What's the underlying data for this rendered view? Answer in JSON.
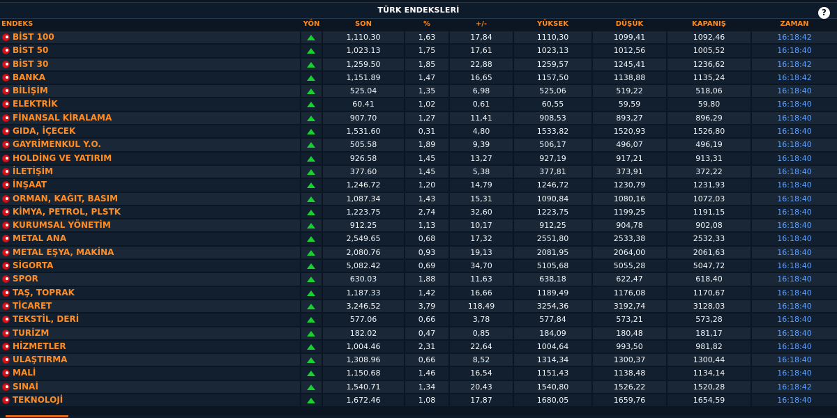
{
  "title": "TÜRK ENDEKSLERİ",
  "help_icon": "?",
  "colors": {
    "accent": "#ff8d24",
    "up": "#18d030",
    "time": "#5fa0ff"
  },
  "columns": [
    "ENDEKS",
    "YÖN",
    "SON",
    "%",
    "+/-",
    "YÜKSEK",
    "DÜŞÜK",
    "KAPANIŞ",
    "ZAMAN"
  ],
  "rows": [
    {
      "name": "BİST 100",
      "dir": "up",
      "son": "1,110.30",
      "pct": "1,63",
      "chg": "17,84",
      "high": "1110,30",
      "low": "1099,41",
      "close": "1092,46",
      "time": "16:18:42"
    },
    {
      "name": "BİST 50",
      "dir": "up",
      "son": "1,023.13",
      "pct": "1,75",
      "chg": "17,61",
      "high": "1023,13",
      "low": "1012,56",
      "close": "1005,52",
      "time": "16:18:40"
    },
    {
      "name": "BİST 30",
      "dir": "up",
      "son": "1,259.50",
      "pct": "1,85",
      "chg": "22,88",
      "high": "1259,57",
      "low": "1245,41",
      "close": "1236,62",
      "time": "16:18:42"
    },
    {
      "name": "BANKA",
      "dir": "up",
      "son": "1,151.89",
      "pct": "1,47",
      "chg": "16,65",
      "high": "1157,50",
      "low": "1138,88",
      "close": "1135,24",
      "time": "16:18:42"
    },
    {
      "name": "BİLİŞİM",
      "dir": "up",
      "son": "525.04",
      "pct": "1,35",
      "chg": "6,98",
      "high": "525,06",
      "low": "519,22",
      "close": "518,06",
      "time": "16:18:40"
    },
    {
      "name": "ELEKTRİK",
      "dir": "up",
      "son": "60.41",
      "pct": "1,02",
      "chg": "0,61",
      "high": "60,55",
      "low": "59,59",
      "close": "59,80",
      "time": "16:18:40"
    },
    {
      "name": "FİNANSAL KİRALAMA",
      "dir": "up",
      "son": "907.70",
      "pct": "1,27",
      "chg": "11,41",
      "high": "908,53",
      "low": "893,27",
      "close": "896,29",
      "time": "16:18:40"
    },
    {
      "name": "GIDA, İÇECEK",
      "dir": "up",
      "son": "1,531.60",
      "pct": "0,31",
      "chg": "4,80",
      "high": "1533,82",
      "low": "1520,93",
      "close": "1526,80",
      "time": "16:18:40"
    },
    {
      "name": "GAYRİMENKUL Y.O.",
      "dir": "up",
      "son": "505.58",
      "pct": "1,89",
      "chg": "9,39",
      "high": "506,17",
      "low": "496,07",
      "close": "496,19",
      "time": "16:18:40"
    },
    {
      "name": "HOLDİNG VE YATIRIM",
      "dir": "up",
      "son": "926.58",
      "pct": "1,45",
      "chg": "13,27",
      "high": "927,19",
      "low": "917,21",
      "close": "913,31",
      "time": "16:18:40"
    },
    {
      "name": "İLETİŞİM",
      "dir": "up",
      "son": "377.60",
      "pct": "1,45",
      "chg": "5,38",
      "high": "377,81",
      "low": "373,91",
      "close": "372,22",
      "time": "16:18:40"
    },
    {
      "name": "İNŞAAT",
      "dir": "up",
      "son": "1,246.72",
      "pct": "1,20",
      "chg": "14,79",
      "high": "1246,72",
      "low": "1230,79",
      "close": "1231,93",
      "time": "16:18:40"
    },
    {
      "name": "ORMAN, KAĞIT, BASIM",
      "dir": "up",
      "son": "1,087.34",
      "pct": "1,43",
      "chg": "15,31",
      "high": "1090,84",
      "low": "1080,16",
      "close": "1072,03",
      "time": "16:18:40"
    },
    {
      "name": "KİMYA, PETROL, PLSTK",
      "dir": "up",
      "son": "1,223.75",
      "pct": "2,74",
      "chg": "32,60",
      "high": "1223,75",
      "low": "1199,25",
      "close": "1191,15",
      "time": "16:18:40"
    },
    {
      "name": "KURUMSAL YÖNETİM",
      "dir": "up",
      "son": "912.25",
      "pct": "1,13",
      "chg": "10,17",
      "high": "912,25",
      "low": "904,78",
      "close": "902,08",
      "time": "16:18:40"
    },
    {
      "name": "METAL ANA",
      "dir": "up",
      "son": "2,549.65",
      "pct": "0,68",
      "chg": "17,32",
      "high": "2551,80",
      "low": "2533,38",
      "close": "2532,33",
      "time": "16:18:40"
    },
    {
      "name": "METAL EŞYA, MAKİNA",
      "dir": "up",
      "son": "2,080.76",
      "pct": "0,93",
      "chg": "19,13",
      "high": "2081,95",
      "low": "2064,00",
      "close": "2061,63",
      "time": "16:18:40"
    },
    {
      "name": "SİGORTA",
      "dir": "up",
      "son": "5,082.42",
      "pct": "0,69",
      "chg": "34,70",
      "high": "5105,68",
      "low": "5055,28",
      "close": "5047,72",
      "time": "16:18:40"
    },
    {
      "name": "SPOR",
      "dir": "up",
      "son": "630.03",
      "pct": "1,88",
      "chg": "11,63",
      "high": "638,18",
      "low": "622,47",
      "close": "618,40",
      "time": "16:18:40"
    },
    {
      "name": "TAŞ, TOPRAK",
      "dir": "up",
      "son": "1,187.33",
      "pct": "1,42",
      "chg": "16,66",
      "high": "1189,49",
      "low": "1176,08",
      "close": "1170,67",
      "time": "16:18:40"
    },
    {
      "name": "TİCARET",
      "dir": "up",
      "son": "3,246.52",
      "pct": "3,79",
      "chg": "118,49",
      "high": "3254,36",
      "low": "3192,74",
      "close": "3128,03",
      "time": "16:18:40"
    },
    {
      "name": "TEKSTİL, DERİ",
      "dir": "up",
      "son": "577.06",
      "pct": "0,66",
      "chg": "3,78",
      "high": "577,84",
      "low": "573,21",
      "close": "573,28",
      "time": "16:18:40"
    },
    {
      "name": "TURİZM",
      "dir": "up",
      "son": "182.02",
      "pct": "0,47",
      "chg": "0,85",
      "high": "184,09",
      "low": "180,48",
      "close": "181,17",
      "time": "16:18:40"
    },
    {
      "name": "HİZMETLER",
      "dir": "up",
      "son": "1,004.46",
      "pct": "2,31",
      "chg": "22,64",
      "high": "1004,64",
      "low": "993,50",
      "close": "981,82",
      "time": "16:18:40"
    },
    {
      "name": "ULAŞTIRMA",
      "dir": "up",
      "son": "1,308.96",
      "pct": "0,66",
      "chg": "8,52",
      "high": "1314,34",
      "low": "1300,37",
      "close": "1300,44",
      "time": "16:18:40"
    },
    {
      "name": "MALİ",
      "dir": "up",
      "son": "1,150.68",
      "pct": "1,46",
      "chg": "16,54",
      "high": "1151,43",
      "low": "1138,48",
      "close": "1134,14",
      "time": "16:18:40"
    },
    {
      "name": "SINAİ",
      "dir": "up",
      "son": "1,540.71",
      "pct": "1,34",
      "chg": "20,43",
      "high": "1540,80",
      "low": "1526,22",
      "close": "1520,28",
      "time": "16:18:42"
    },
    {
      "name": "TEKNOLOJİ",
      "dir": "up",
      "son": "1,672.46",
      "pct": "1,08",
      "chg": "17,87",
      "high": "1680,05",
      "low": "1659,76",
      "close": "1654,59",
      "time": "16:18:40"
    }
  ]
}
